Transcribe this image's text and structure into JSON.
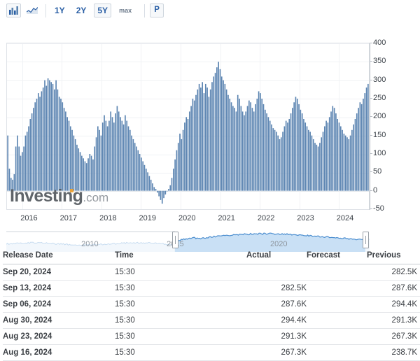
{
  "toolbar": {
    "chart_type_bar": "bar-chart-icon",
    "chart_type_line": "line-chart-icon",
    "ranges": [
      {
        "label": "1Y",
        "active": false
      },
      {
        "label": "2Y",
        "active": false
      },
      {
        "label": "5Y",
        "active": true
      },
      {
        "label": "max",
        "active": false
      }
    ],
    "pattern_label": "P"
  },
  "chart_data": {
    "type": "bar",
    "title": "",
    "xlabel": "",
    "ylabel": "",
    "ylim": [
      -50,
      400
    ],
    "yticks": [
      -50,
      0,
      50,
      100,
      150,
      200,
      250,
      300,
      350,
      400
    ],
    "xticks": [
      "2016",
      "2017",
      "2018",
      "2019",
      "2020",
      "2021",
      "2022",
      "2023",
      "2024"
    ],
    "grid": true,
    "legend": "none",
    "bar_color": "#5b84b1",
    "x_start": 2015.62,
    "x_end": 2024.78,
    "values": [
      150,
      60,
      35,
      30,
      45,
      120,
      150,
      120,
      95,
      105,
      120,
      150,
      160,
      175,
      195,
      210,
      225,
      240,
      250,
      265,
      255,
      270,
      280,
      300,
      285,
      305,
      300,
      295,
      290,
      275,
      300,
      275,
      255,
      250,
      240,
      225,
      215,
      200,
      190,
      175,
      165,
      150,
      140,
      125,
      115,
      105,
      95,
      88,
      80,
      75,
      88,
      100,
      95,
      85,
      120,
      145,
      175,
      165,
      150,
      185,
      205,
      190,
      175,
      190,
      215,
      200,
      185,
      210,
      230,
      215,
      200,
      190,
      180,
      205,
      190,
      175,
      165,
      150,
      140,
      130,
      120,
      110,
      100,
      90,
      80,
      70,
      60,
      50,
      40,
      30,
      20,
      10,
      5,
      -5,
      -15,
      -25,
      -35,
      -20,
      -10,
      0,
      5,
      15,
      35,
      60,
      85,
      110,
      130,
      155,
      140,
      165,
      185,
      200,
      195,
      215,
      230,
      250,
      245,
      260,
      275,
      290,
      280,
      295,
      265,
      290,
      280,
      255,
      275,
      295,
      310,
      320,
      335,
      350,
      330,
      310,
      300,
      290,
      275,
      260,
      250,
      240,
      230,
      225,
      215,
      260,
      250,
      230,
      215,
      205,
      215,
      230,
      245,
      240,
      225,
      215,
      235,
      250,
      270,
      265,
      250,
      235,
      220,
      210,
      200,
      190,
      180,
      170,
      165,
      160,
      150,
      140,
      145,
      160,
      175,
      190,
      185,
      195,
      210,
      225,
      240,
      255,
      250,
      235,
      220,
      210,
      195,
      185,
      175,
      165,
      160,
      150,
      140,
      130,
      125,
      120,
      130,
      145,
      160,
      175,
      190,
      185,
      200,
      215,
      230,
      225,
      210,
      195,
      185,
      175,
      165,
      155,
      150,
      145,
      140,
      150,
      165,
      180,
      195,
      210,
      225,
      240,
      235,
      250,
      265,
      280,
      290
    ]
  },
  "navigator": {
    "labels": [
      "2010",
      "2015",
      "2020"
    ],
    "selection_start_pct": 46.4,
    "selection_end_pct": 98.8
  },
  "watermark": {
    "brand": "Investing",
    "suffix": ".com"
  },
  "table": {
    "columns": [
      "Release Date",
      "Time",
      "Actual",
      "Forecast",
      "Previous"
    ],
    "rows": [
      {
        "date": "Sep 20, 2024",
        "time": "15:30",
        "actual": "",
        "forecast": "",
        "previous": "282.5K"
      },
      {
        "date": "Sep 13, 2024",
        "time": "15:30",
        "actual": "282.5K",
        "forecast": "",
        "previous": "287.6K"
      },
      {
        "date": "Sep 06, 2024",
        "time": "15:30",
        "actual": "287.6K",
        "forecast": "",
        "previous": "294.4K"
      },
      {
        "date": "Aug 30, 2024",
        "time": "15:30",
        "actual": "294.4K",
        "forecast": "",
        "previous": "291.3K"
      },
      {
        "date": "Aug 23, 2024",
        "time": "15:30",
        "actual": "291.3K",
        "forecast": "",
        "previous": "267.3K"
      },
      {
        "date": "Aug 16, 2024",
        "time": "15:30",
        "actual": "267.3K",
        "forecast": "",
        "previous": "238.7K"
      }
    ]
  }
}
